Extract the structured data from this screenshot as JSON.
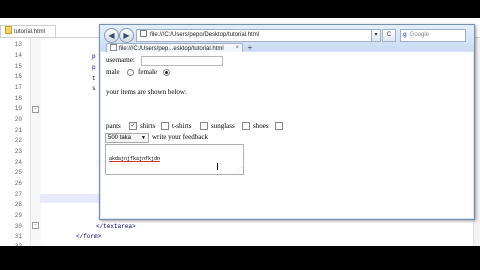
{
  "editor": {
    "tab_label": "tutorial.html",
    "line_numbers": [
      "13",
      "14",
      "15",
      "16",
      "17",
      "18",
      "19",
      "20",
      "21",
      "22",
      "23",
      "24",
      "25",
      "26",
      "27",
      "28",
      "29",
      "30",
      "31",
      "32"
    ],
    "code_fragments": {
      "p1": "p",
      "p2": "p",
      "t": "t",
      "s1": "s",
      "d": "</textarea>",
      "form": "</form>"
    }
  },
  "browser": {
    "url": "file:///C:/Users/pepo/Desktop/tutorial.html",
    "tab_title": "file:///C:/Users/pep...esktop/tutorial.html",
    "tab_close": "×",
    "new_tab": "+",
    "search_engine": "g",
    "search_placeholder": "Google",
    "reload": "C",
    "back": "◀",
    "forward": "▶"
  },
  "page": {
    "username_label": "username:",
    "male_label": "male",
    "female_label": "female",
    "items_heading": "your items are shown below:",
    "checkboxes": [
      {
        "label": "pants",
        "checked": true
      },
      {
        "label": "shirts",
        "checked": false
      },
      {
        "label": "t-shirts",
        "checked": false
      },
      {
        "label": "sunglass",
        "checked": false
      },
      {
        "label": "shoes",
        "checked": false
      }
    ],
    "select_value": "500 taka",
    "feedback_label": "write your feedback",
    "textarea_value": "akdajnjfkajnfkjdn"
  },
  "colors": {
    "accent": "#d6e4f5",
    "editor_highlight": "#e8e8ff"
  }
}
